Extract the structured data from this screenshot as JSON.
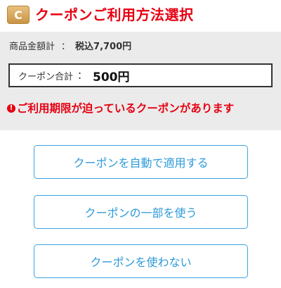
{
  "header": {
    "badge_letter": "C",
    "title": "クーポンご利用方法選択",
    "title_color": "#e60012"
  },
  "summary": {
    "subtotal_label": "商品金額計",
    "subtotal_colon": "：",
    "subtotal_value": "税込7,700円",
    "coupon_total_label": "クーポン合計",
    "coupon_total_colon": "：",
    "coupon_total_value": "500円",
    "background": "#ebebeb"
  },
  "warning": {
    "icon": "exclamation-circle-icon",
    "icon_glyph": "!",
    "text": "ご利用期限が迫っているクーポンがあります"
  },
  "options": [
    {
      "label": "クーポンを自動で適用する"
    },
    {
      "label": "クーポンの一部を使う"
    },
    {
      "label": "クーポンを使わない"
    }
  ],
  "accent_color": "#2e9ad8"
}
